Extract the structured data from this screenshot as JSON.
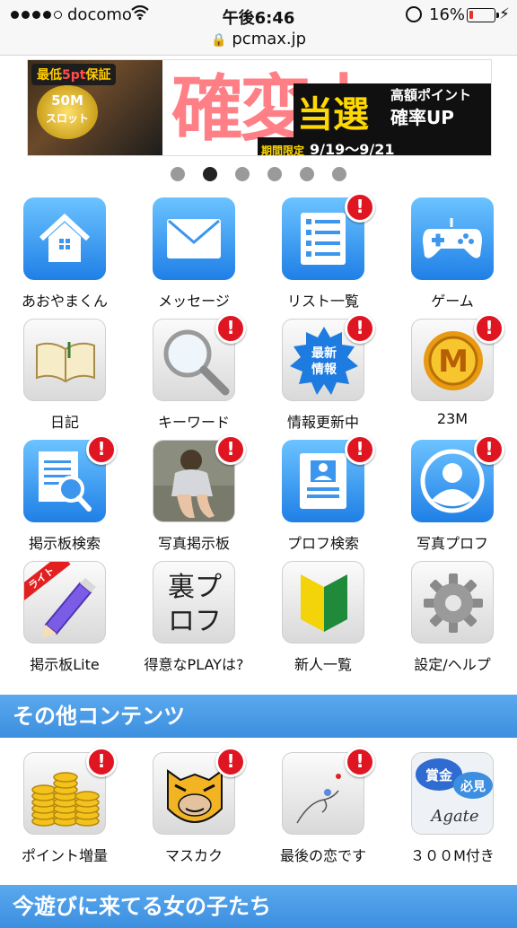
{
  "status": {
    "carrier": "docomo",
    "time": "午後6:46",
    "battery_pct": "16%",
    "battery_level": 0.16,
    "url": "pcmax.jp",
    "accent_red": "#e01522"
  },
  "banner": {
    "tag_min": "最低",
    "tag_pt": "5pt",
    "tag_guarantee": "保証",
    "coin_line1": "50M",
    "coin_line2": "スロット",
    "bg_text": "確変中",
    "tousen": "当選",
    "kogaku": "高額ポイント",
    "kakuritsu": "確率UP",
    "period_label": "期間限定",
    "period": "9/19～9/21"
  },
  "pager": {
    "count": 6,
    "active": 1
  },
  "menu": [
    {
      "label": "あおやまくん",
      "icon": "house-icon",
      "style": "blue",
      "badge": ""
    },
    {
      "label": "メッセージ",
      "icon": "envelope-icon",
      "style": "blue",
      "badge": ""
    },
    {
      "label": "リスト一覧",
      "icon": "list-icon",
      "style": "blue",
      "badge": "!"
    },
    {
      "label": "ゲーム",
      "icon": "gamepad-icon",
      "style": "blue",
      "badge": ""
    },
    {
      "label": "日記",
      "icon": "open-book-icon",
      "style": "gray",
      "badge": ""
    },
    {
      "label": "キーワード",
      "icon": "magnifier-icon",
      "style": "gray",
      "badge": "!"
    },
    {
      "label": "情報更新中",
      "icon": "new-info-starburst-icon",
      "style": "gray",
      "badge": "!",
      "icon_text": "最新情報"
    },
    {
      "label": "23M",
      "icon": "m-coin-icon",
      "style": "gray",
      "badge": "!",
      "icon_text": "M"
    },
    {
      "label": "掲示板検索",
      "icon": "document-search-icon",
      "style": "blue",
      "badge": "!"
    },
    {
      "label": "写真掲示板",
      "icon": "photo-thumbnail-icon",
      "style": "gray",
      "badge": "!"
    },
    {
      "label": "プロフ検索",
      "icon": "profile-card-icon",
      "style": "blue",
      "badge": "!"
    },
    {
      "label": "写真プロフ",
      "icon": "user-circle-icon",
      "style": "blue",
      "badge": "!"
    },
    {
      "label": "掲示板Lite",
      "icon": "pencil-icon",
      "style": "gray",
      "badge": "",
      "ribbon": "ライト"
    },
    {
      "label": "得意なPLAYは?",
      "icon": "handwritten-text-icon",
      "style": "gray",
      "badge": "",
      "icon_text": "裏プロフ"
    },
    {
      "label": "新人一覧",
      "icon": "beginner-mark-icon",
      "style": "gray",
      "badge": ""
    },
    {
      "label": "設定/ヘルプ",
      "icon": "gear-icon",
      "style": "gray",
      "badge": ""
    }
  ],
  "sections": {
    "other": "その他コンテンツ",
    "girls": "今遊びに来てる女の子たち"
  },
  "other": [
    {
      "label": "ポイント増量",
      "icon": "coin-stacks-icon",
      "style": "gray",
      "badge": "!"
    },
    {
      "label": "マスカク",
      "icon": "tiger-mask-icon",
      "style": "gray",
      "badge": "!"
    },
    {
      "label": "最後の恋です",
      "icon": "hand-sketch-icon",
      "style": "gray",
      "badge": "!"
    },
    {
      "label": "３００M付き",
      "icon": "agate-icon",
      "style": "gray",
      "badge": "",
      "icon_text_1": "賞金",
      "icon_text_2": "必見",
      "icon_text_3": "Agate"
    }
  ]
}
